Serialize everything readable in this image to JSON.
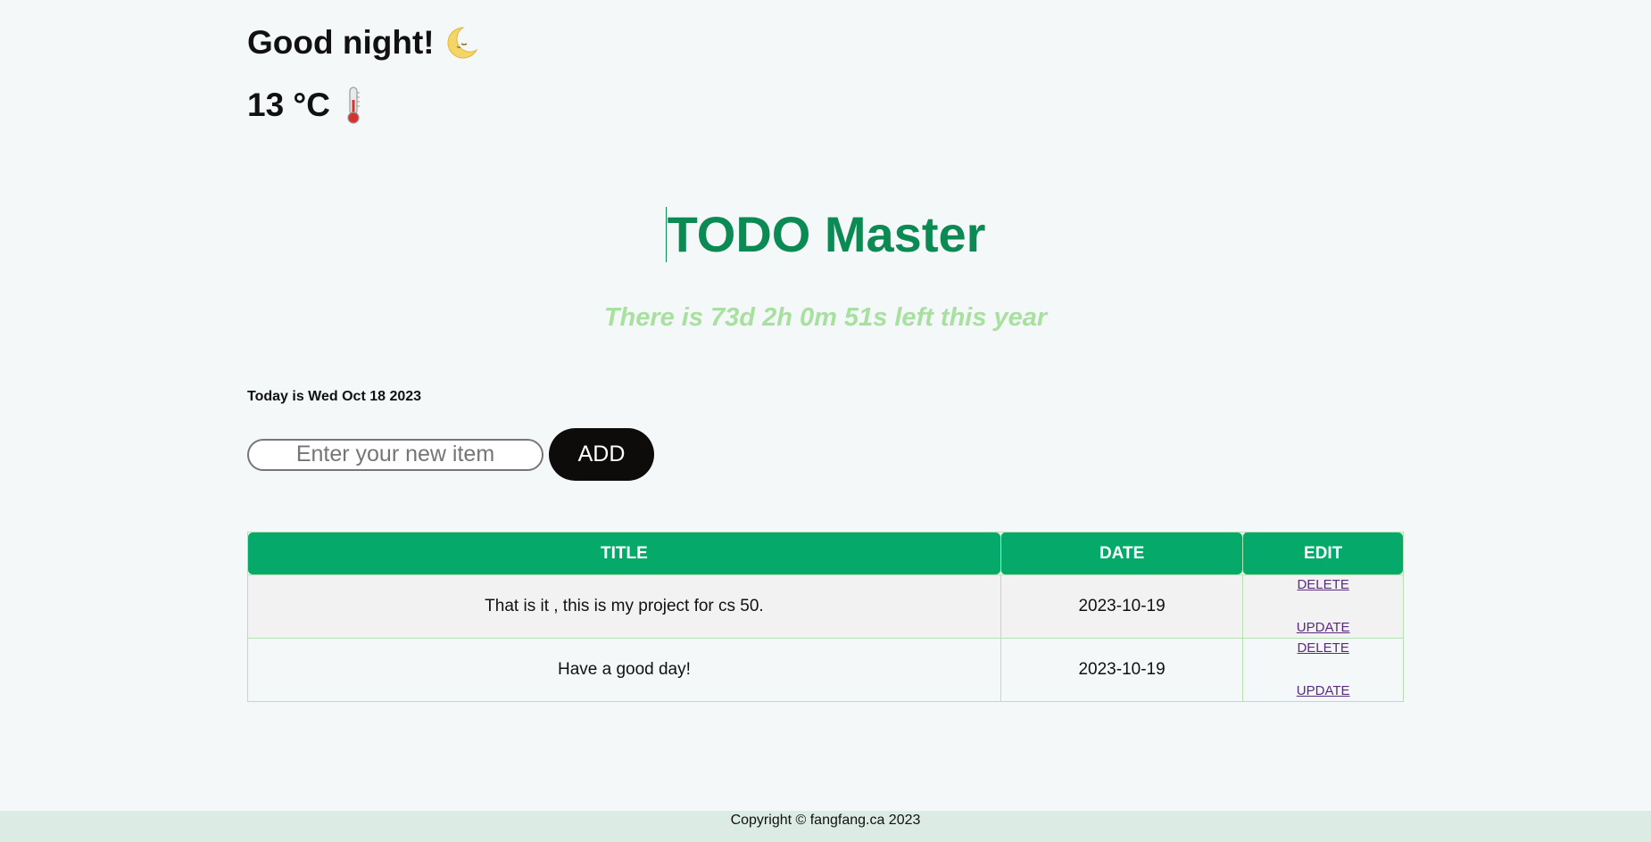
{
  "header": {
    "greeting": "Good night!",
    "greeting_icon": "moon-icon",
    "temperature": "13 °C",
    "temperature_icon": "thermometer-icon"
  },
  "app": {
    "title": "TODO Master",
    "title_color": "#0b8a54",
    "countdown": "There is 73d 2h 0m 51s left this year",
    "countdown_color": "#a8e0a0",
    "today": "Today is Wed Oct 18 2023"
  },
  "form": {
    "input_placeholder": "Enter your new item",
    "input_value": "",
    "add_label": "ADD"
  },
  "table": {
    "header_color": "#05aa6b",
    "columns": [
      "TITLE",
      "DATE",
      "EDIT"
    ],
    "rows": [
      {
        "title": "That is it , this is my project for cs 50.",
        "date": "2023-10-19",
        "delete_label": "DELETE",
        "update_label": "UPDATE"
      },
      {
        "title": "Have a good day!",
        "date": "2023-10-19",
        "delete_label": "DELETE",
        "update_label": "UPDATE"
      }
    ]
  },
  "footer": {
    "copyright": "Copyright © fangfang.ca 2023"
  }
}
